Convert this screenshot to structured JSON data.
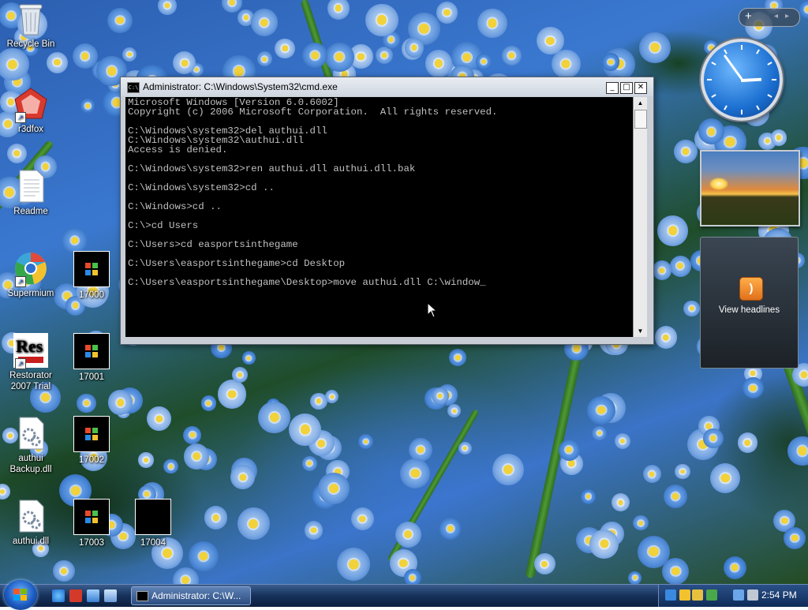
{
  "desktop": {
    "icons": [
      {
        "label": "Recycle Bin"
      },
      {
        "label": "r3dfox"
      },
      {
        "label": "Readme"
      },
      {
        "label": "Supermium"
      },
      {
        "label": "17000"
      },
      {
        "label": "Restorator 2007 Trial"
      },
      {
        "label": "17001"
      },
      {
        "label": "authui Backup.dll"
      },
      {
        "label": "17002"
      },
      {
        "label": "authui.dll"
      },
      {
        "label": "17003"
      },
      {
        "label": "17004"
      }
    ]
  },
  "cmd_window": {
    "title": "Administrator: C:\\Windows\\System32\\cmd.exe",
    "icon_text": "C:\\",
    "minimize": "_",
    "maximize": "□",
    "close": "✕",
    "lines": [
      "Microsoft Windows [Version 6.0.6002]",
      "Copyright (c) 2006 Microsoft Corporation.  All rights reserved.",
      "",
      "C:\\Windows\\system32>del authui.dll",
      "C:\\Windows\\system32\\authui.dll",
      "Access is denied.",
      "",
      "C:\\Windows\\system32>ren authui.dll authui.dll.bak",
      "",
      "C:\\Windows\\system32>cd ..",
      "",
      "C:\\Windows>cd ..",
      "",
      "C:\\>cd Users",
      "",
      "C:\\Users>cd easportsinthegame",
      "",
      "C:\\Users\\easportsinthegame>cd Desktop",
      "",
      "C:\\Users\\easportsinthegame\\Desktop>move authui.dll C:\\window_"
    ]
  },
  "sidebar": {
    "add_gadget": "+",
    "prev": "◂",
    "next": "▸",
    "feed_label": "View headlines",
    "rss_glyph": ")",
    "clock_time": {
      "hour": 2,
      "minute": 54
    }
  },
  "taskbar": {
    "task_label": "Administrator: C:\\W...",
    "time": "2:54 PM"
  },
  "colors": {
    "console_bg": "#000000",
    "console_fg": "#c0c0c0",
    "taskbar": "#16315a"
  },
  "icons": [
    "recycle-bin-icon",
    "browser-icon",
    "text-file-icon",
    "dll-file-icon",
    "windows-start-icon",
    "ie-icon",
    "rss-icon",
    "clock-icon"
  ]
}
